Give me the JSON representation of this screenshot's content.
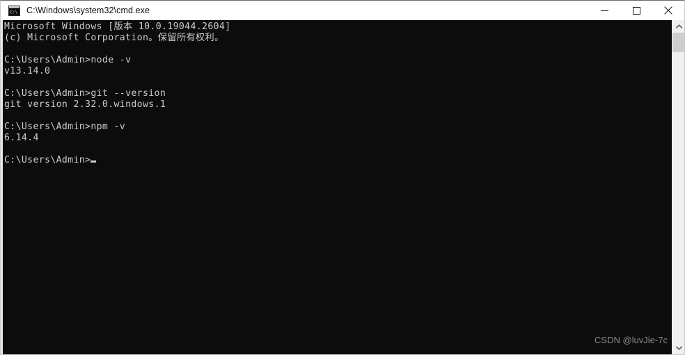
{
  "window": {
    "title": "C:\\Windows\\system32\\cmd.exe",
    "app_icon": "cmd-console-icon",
    "controls": {
      "minimize_label": "Minimize",
      "maximize_label": "Maximize",
      "close_label": "Close"
    }
  },
  "console": {
    "background_color": "#0c0c0c",
    "foreground_color": "#cccccc",
    "lines": [
      "Microsoft Windows [版本 10.0.19044.2604]",
      "(c) Microsoft Corporation。保留所有权利。",
      "",
      "C:\\Users\\Admin>node -v",
      "v13.14.0",
      "",
      "C:\\Users\\Admin>git --version",
      "git version 2.32.0.windows.1",
      "",
      "C:\\Users\\Admin>npm -v",
      "6.14.4",
      "",
      "C:\\Users\\Admin>"
    ],
    "prompt": "C:\\Users\\Admin>",
    "cursor_visible": true,
    "commands": [
      {
        "command": "node -v",
        "output": "v13.14.0"
      },
      {
        "command": "git --version",
        "output": "git version 2.32.0.windows.1"
      },
      {
        "command": "npm -v",
        "output": "6.14.4"
      }
    ]
  },
  "watermark": {
    "text": "CSDN @luvJie-7c"
  },
  "scrollbar": {
    "up_arrow_icon": "chevron-up-icon",
    "down_arrow_icon": "chevron-down-icon",
    "track_color": "#f0f0f0",
    "thumb_color": "#cdcdcd"
  }
}
